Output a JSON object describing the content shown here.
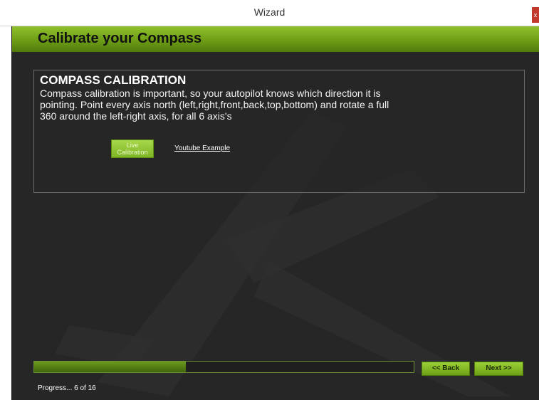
{
  "window": {
    "title": "Wizard",
    "close_label": "x"
  },
  "header": {
    "title": "Calibrate your Compass"
  },
  "panel": {
    "title": "COMPASS CALIBRATION",
    "description": "Compass calibration is important, so your autopilot knows which direction it is pointing. Point every axis north (left,right,front,back,top,bottom) and rotate a full 360 around the left-right axis, for all 6 axis's",
    "live_button": "Live Calibration",
    "youtube_link": "Youtube Example"
  },
  "progress": {
    "current": 6,
    "total": 16,
    "fraction": 0.4,
    "text": "Progress... 6 of 16"
  },
  "nav": {
    "back_label": "<< Back",
    "next_label": "Next >>"
  },
  "colors": {
    "accent": "#7db526",
    "background": "#262626",
    "header_dark": "#4f7a0c"
  },
  "background_icon": "airplane-watermark"
}
